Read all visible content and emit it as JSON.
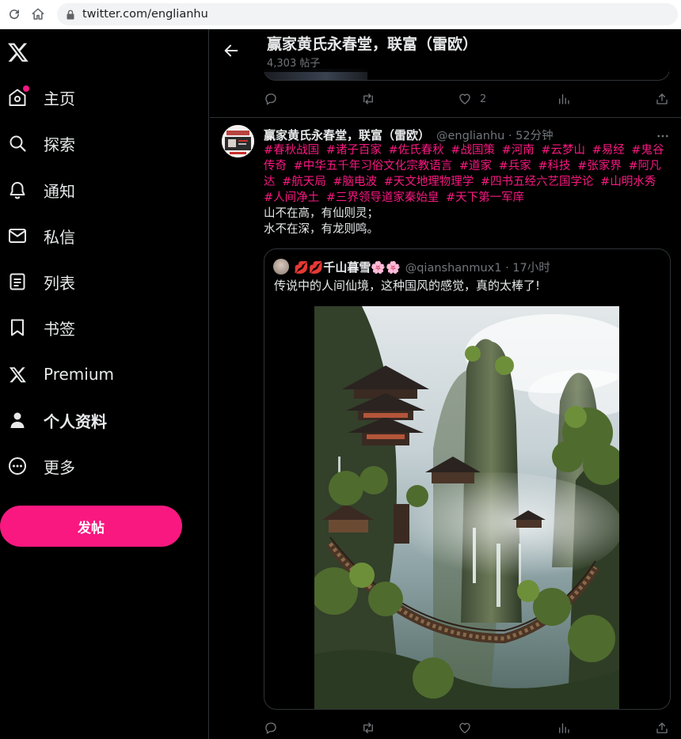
{
  "browser": {
    "url": "twitter.com/englianhu"
  },
  "sidebar": {
    "items": [
      {
        "label": "主页",
        "icon": "home-icon"
      },
      {
        "label": "探索",
        "icon": "search-icon"
      },
      {
        "label": "通知",
        "icon": "bell-icon"
      },
      {
        "label": "私信",
        "icon": "mail-icon"
      },
      {
        "label": "列表",
        "icon": "list-icon"
      },
      {
        "label": "书签",
        "icon": "bookmark-icon"
      },
      {
        "label": "Premium",
        "icon": "x-logo-icon"
      },
      {
        "label": "个人资料",
        "icon": "person-icon"
      },
      {
        "label": "更多",
        "icon": "more-circle-icon"
      }
    ],
    "post_button": "发帖"
  },
  "header": {
    "title": "赢家黄氏永春堂，联富（雷欧）",
    "subtitle": "4,303 帖子"
  },
  "prev_tweet": {
    "like_count": "2"
  },
  "tweet": {
    "name": "赢家黄氏永春堂，联富（雷欧）",
    "handle_time": "@englianhu · 52分钟",
    "hashtags": [
      "#春秋战国",
      "#诸子百家",
      "#佐氏春秋",
      "#战国策",
      "#河南",
      "#云梦山",
      "#易经",
      "#鬼谷传奇",
      "#中华五千年习俗文化宗教语言",
      "#道家",
      "#兵家",
      "#科技",
      "#张家界",
      "#阿凡达",
      "#航天局",
      "#脑电波",
      "#天文地理物理学",
      "#四书五经六艺国学论",
      "#山明水秀",
      "#人间净土",
      "#三界领导道家秦始皇",
      "#天下第一军庠"
    ],
    "lines": [
      "山不在高，有仙则灵；",
      "水不在深，有龙则鸣。"
    ],
    "quote": {
      "name": "💋💋千山暮雪🌸🌸",
      "handle_time": "@qianshanmux1 · 17小时",
      "text": "传说中的人间仙境，这种国风的感觉，真的太棒了!"
    }
  },
  "colors": {
    "accent": "#f91880",
    "background": "#000000",
    "muted": "#71767b",
    "border": "#2f3336"
  }
}
